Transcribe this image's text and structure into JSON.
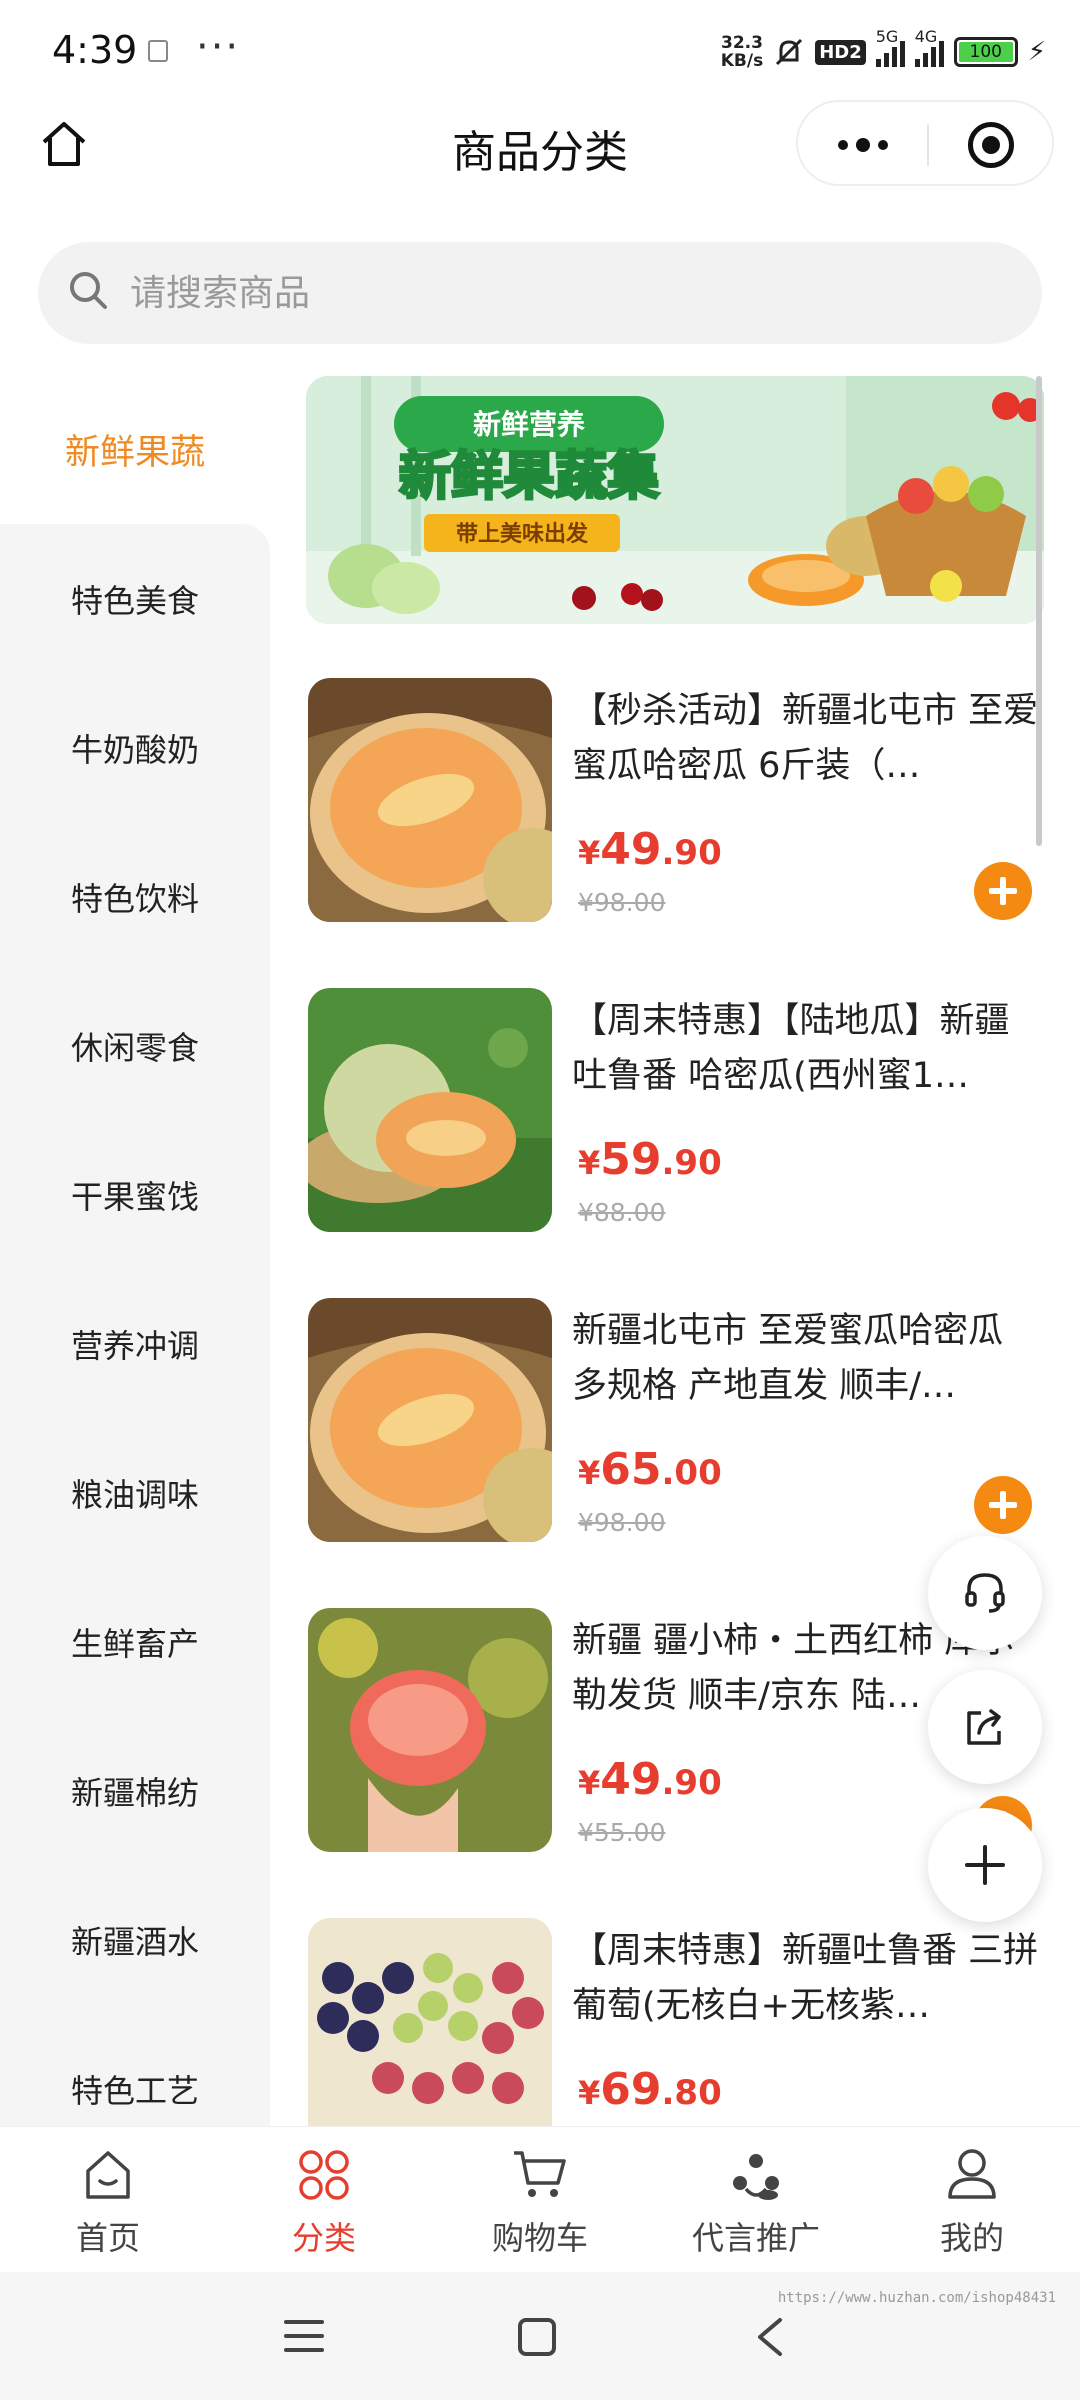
{
  "status_bar": {
    "time": "4:39",
    "dots": "···",
    "speed_value": "32.3",
    "speed_unit": "KB/s",
    "hd_label": "HD2",
    "signal_1_label": "5G",
    "signal_2_label": "4G",
    "battery": "100"
  },
  "header": {
    "title": "商品分类"
  },
  "search": {
    "placeholder": "请搜索商品"
  },
  "sidebar": {
    "active": "新鲜果蔬",
    "items": [
      "特色美食",
      "牛奶酸奶",
      "特色饮料",
      "休闲零食",
      "干果蜜饯",
      "营养冲调",
      "粮油调味",
      "生鲜畜产",
      "新疆棉纺",
      "新疆酒水",
      "特色工艺"
    ]
  },
  "banner": {
    "tag": "新鲜营养",
    "headline": "新鲜果蔬集",
    "ribbon": "带上美味出发"
  },
  "products": [
    {
      "title": "【秒杀活动】新疆北屯市 至爱蜜瓜哈密瓜 6斤装（…",
      "currency": "¥",
      "price_int": "49",
      "price_dec": ".90",
      "old_price": "¥98.00"
    },
    {
      "title": "【周末特惠】【陆地瓜】新疆吐鲁番 哈密瓜(西州蜜1…",
      "currency": "¥",
      "price_int": "59",
      "price_dec": ".90",
      "old_price": "¥88.00"
    },
    {
      "title": "新疆北屯市 至爱蜜瓜哈密瓜 多规格 产地直发 顺丰/…",
      "currency": "¥",
      "price_int": "65",
      "price_dec": ".00",
      "old_price": "¥98.00"
    },
    {
      "title": "新疆 疆小柿・土西红柿 库尔勒发货 顺丰/京东 陆…",
      "currency": "¥",
      "price_int": "49",
      "price_dec": ".90",
      "old_price": "¥55.00"
    },
    {
      "title": "【周末特惠】新疆吐鲁番 三拼葡萄(无核白+无核紫…",
      "currency": "¥",
      "price_int": "69",
      "price_dec": ".80",
      "old_price": ""
    }
  ],
  "tabbar": {
    "items": [
      "首页",
      "分类",
      "购物车",
      "代言推广",
      "我的"
    ]
  },
  "watermark": "https://www.huzhan.com/ishop48431",
  "colors": {
    "accent_orange": "#f08a24",
    "price_red": "#e73d2f",
    "add_button": "#f58a12"
  }
}
